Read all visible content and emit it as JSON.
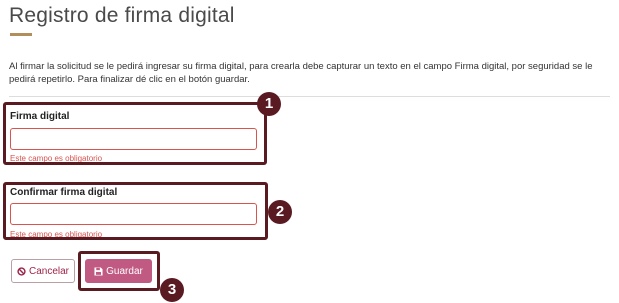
{
  "page": {
    "title": "Registro de firma digital",
    "description": "Al firmar la solicitud se le pedirá ingresar su firma digital, para crearla debe capturar un texto en el campo Firma digital, por seguridad se le pedirá repetirlo. Para finalizar dé clic en el botón guardar."
  },
  "form": {
    "signature": {
      "label": "Firma digital",
      "value": "",
      "error": "Este campo es obligatorio"
    },
    "confirm_signature": {
      "label": "Confirmar firma digital",
      "value": "",
      "error": "Este campo es obligatorio"
    }
  },
  "buttons": {
    "cancel_label": "Cancelar",
    "cancel_icon": "ban-icon",
    "save_label": "Guardar",
    "save_icon": "floppy-disk-icon"
  },
  "annotations": {
    "step1": "1",
    "step2": "2",
    "step3": "3"
  },
  "colors": {
    "accent_gold": "#b38e5d",
    "error_red": "#d9534f",
    "annotation_maroon": "#5a1a22",
    "save_button": "#c15a82",
    "cancel_text": "#9d2449"
  }
}
